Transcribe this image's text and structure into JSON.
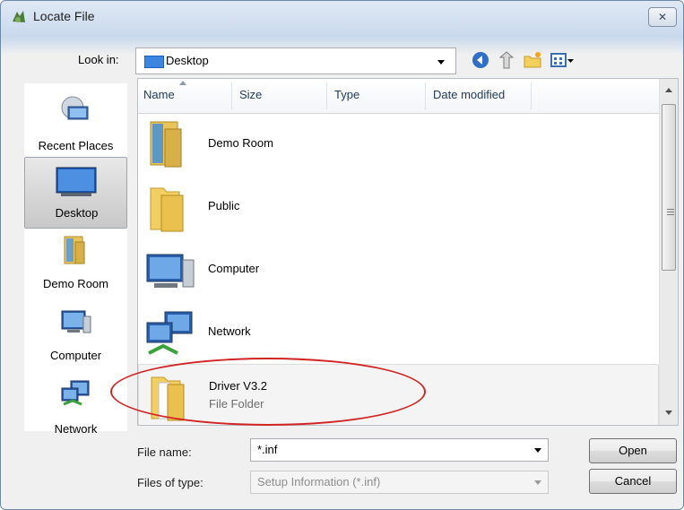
{
  "window": {
    "title": "Locate File",
    "close_glyph": "✕"
  },
  "toolbar": {
    "look_in_label": "Look in:",
    "look_in_value": "Desktop",
    "icons": [
      "back-icon",
      "up-folder-icon",
      "new-folder-icon",
      "views-icon"
    ]
  },
  "places": [
    {
      "label": "Recent Places",
      "icon": "recent-places-icon",
      "selected": false
    },
    {
      "label": "Desktop",
      "icon": "desktop-icon",
      "selected": true
    },
    {
      "label": "Demo Room",
      "icon": "demo-room-icon",
      "selected": false
    },
    {
      "label": "Computer",
      "icon": "computer-icon",
      "selected": false
    },
    {
      "label": "Network",
      "icon": "network-icon",
      "selected": false
    }
  ],
  "columns": [
    "Name",
    "Size",
    "Type",
    "Date modified"
  ],
  "files": [
    {
      "name": "Demo Room",
      "icon": "demo-room-folder-icon"
    },
    {
      "name": "Public",
      "icon": "folder-icon"
    },
    {
      "name": "Computer",
      "icon": "computer-icon"
    },
    {
      "name": "Network",
      "icon": "network-icon"
    },
    {
      "name": "Driver V3.2",
      "type_label": "File Folder",
      "icon": "folder-icon",
      "highlighted": true
    }
  ],
  "bottom": {
    "file_name_label": "File name:",
    "file_name_value": "*.inf",
    "file_type_label": "Files of type:",
    "file_type_value": "Setup Information (*.inf)",
    "open_label": "Open",
    "cancel_label": "Cancel"
  },
  "colors": {
    "annotation": "#d12424",
    "selection": "#c8c8c8"
  }
}
